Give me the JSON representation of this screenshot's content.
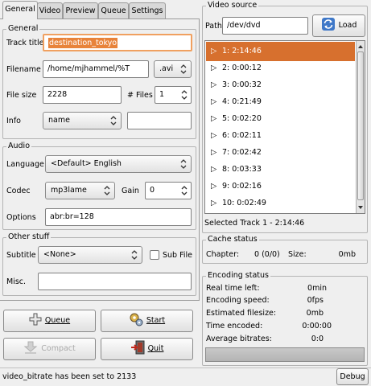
{
  "tabs": [
    "General",
    "Video",
    "Preview",
    "Queue",
    "Settings"
  ],
  "general": {
    "frame_title": "General",
    "track_title_label": "Track title",
    "track_title_value": "destination_tokyo",
    "filename_label": "Filename",
    "filename_value": "/home/mjhammel/%T",
    "ext_value": ".avi",
    "filesize_label": "File size",
    "filesize_value": "2228",
    "files_label": "# Files",
    "files_value": "1",
    "info_label": "Info",
    "info_value": "name",
    "info_extra": ""
  },
  "audio": {
    "frame_title": "Audio",
    "language_label": "Language",
    "language_value": "<Default> English",
    "codec_label": "Codec",
    "codec_value": "mp3lame",
    "gain_label": "Gain",
    "gain_value": "0",
    "options_label": "Options",
    "options_value": "abr:br=128"
  },
  "other": {
    "frame_title": "Other stuff",
    "subtitle_label": "Subtitle",
    "subtitle_value": "<None>",
    "subfile_label": "Sub File",
    "misc_label": "Misc.",
    "misc_value": ""
  },
  "buttons": {
    "queue": "Queue",
    "start": "Start",
    "compact": "Compact",
    "quit": "Quit",
    "debug": "Debug",
    "load": "Load"
  },
  "video_source": {
    "frame_title": "Video source",
    "path_label": "Path",
    "path_value": "/dev/dvd",
    "tracks": [
      "1: 2:14:46",
      "2: 0:00:12",
      "3: 0:00:32",
      "4: 0:21:49",
      "5: 0:02:20",
      "6: 0:02:11",
      "7: 0:02:42",
      "8: 0:03:33",
      "9: 0:02:16",
      "10: 0:02:49"
    ],
    "selected_track": 0,
    "selected_text": "Selected Track 1 - 2:14:46"
  },
  "cache": {
    "frame_title": "Cache status",
    "chapter_label": "Chapter:",
    "chapter_value": "0 (0/0)",
    "size_label": "Size:",
    "size_value": "0mb"
  },
  "encoding": {
    "frame_title": "Encoding status",
    "rows": [
      {
        "label": "Real time left:",
        "value": "0min"
      },
      {
        "label": "Encoding speed:",
        "value": "0fps"
      },
      {
        "label": "Estimated filesize:",
        "value": "0mb"
      },
      {
        "label": "Time encoded:",
        "value": "0:00:00"
      },
      {
        "label": "Average bitrates:",
        "value": "0:0"
      }
    ],
    "progress": 0
  },
  "status_bar": "video_bitrate has been set to 2133"
}
